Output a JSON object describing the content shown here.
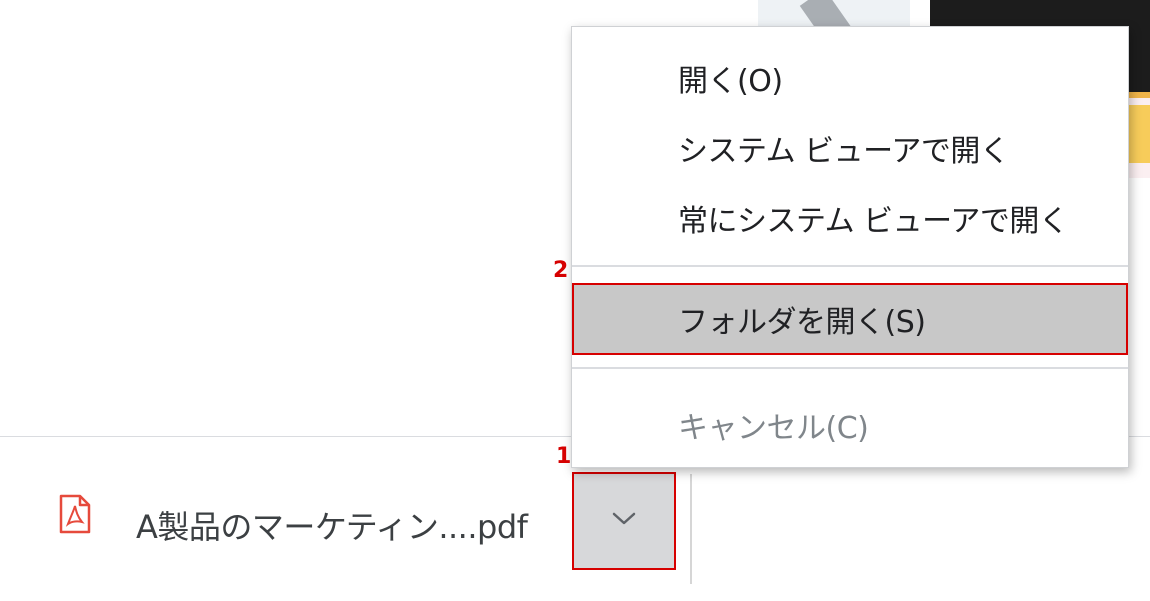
{
  "context_menu": {
    "items": [
      {
        "label": "開く(O)"
      },
      {
        "label": "システム ビューアで開く"
      },
      {
        "label": "常にシステム ビューアで開く"
      },
      {
        "label": "フォルダを開く(S)"
      },
      {
        "label": "キャンセル(C)"
      }
    ]
  },
  "download": {
    "filename": "A製品のマーケティン....pdf",
    "icon": "pdf-icon"
  },
  "annotations": {
    "step1": "1",
    "step2": "2"
  },
  "colors": {
    "highlight_border": "#d60000",
    "highlight_fill": "#c8c8c8",
    "pdf_icon": "#e64a3c"
  }
}
